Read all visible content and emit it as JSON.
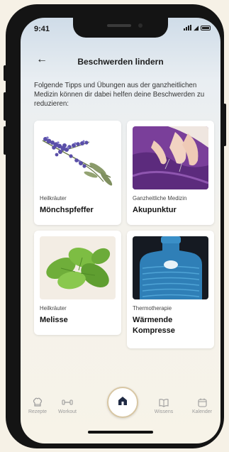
{
  "status": {
    "time": "9:41"
  },
  "header": {
    "title": "Beschwerden lindern",
    "back_icon": "arrow-left-icon"
  },
  "intro": "Folgende Tipps und Übungen aus der ganzheitlichen Medizin können dir dabei helfen deine Beschwerden zu reduzieren:",
  "cards": [
    {
      "category": "Heilkräuter",
      "name": "Mönchspfeffer"
    },
    {
      "category": "Ganzheitliche Medizin",
      "name": "Akupunktur"
    },
    {
      "category": "Heilkräuter",
      "name": "Melisse"
    },
    {
      "category": "Thermotherapie",
      "name": "Wärmende Kompresse"
    }
  ],
  "nav": {
    "items": [
      {
        "label": "Rezepte",
        "icon": "chef-hat-icon"
      },
      {
        "label": "Workout",
        "icon": "dumbbell-icon"
      },
      {
        "label": "Wissens",
        "icon": "book-icon"
      },
      {
        "label": "Kalender",
        "icon": "calendar-icon"
      }
    ],
    "home_icon": "home-icon"
  },
  "colors": {
    "accent": "#d8c7a4",
    "nav_gray": "#9b9b9b"
  }
}
